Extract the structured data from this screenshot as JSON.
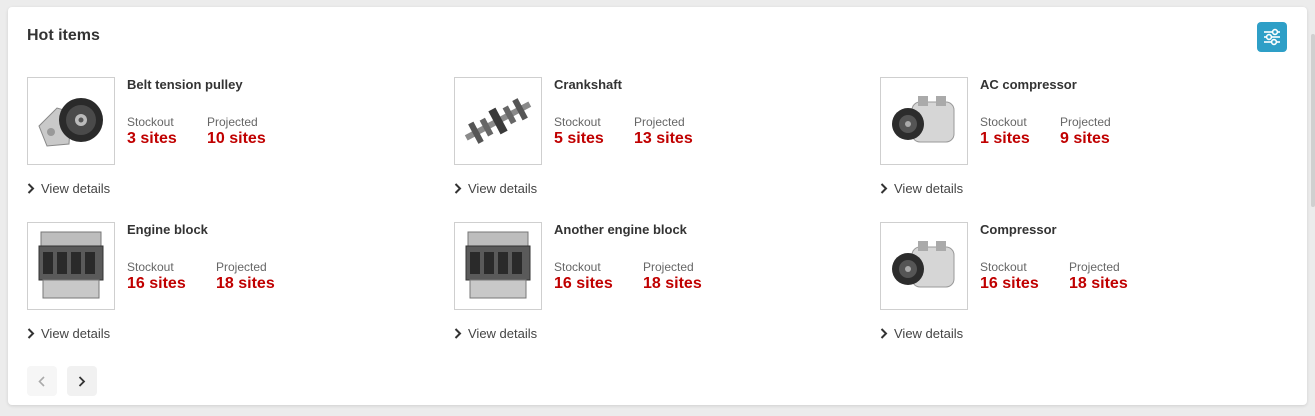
{
  "widget": {
    "title": "Hot items",
    "filter_icon": "sliders-icon",
    "accent_color": "#2e9fc7",
    "value_color": "#c00000"
  },
  "items": [
    {
      "name": "Belt tension pulley",
      "stockout_label": "Stockout",
      "stockout_value": "3 sites",
      "projected_label": "Projected",
      "projected_value": "10 sites",
      "link": "View details",
      "image": "pulley"
    },
    {
      "name": "Crankshaft",
      "stockout_label": "Stockout",
      "stockout_value": "5 sites",
      "projected_label": "Projected",
      "projected_value": "13 sites",
      "link": "View details",
      "image": "crankshaft"
    },
    {
      "name": "AC compressor",
      "stockout_label": "Stockout",
      "stockout_value": "1 sites",
      "projected_label": "Projected",
      "projected_value": "9 sites",
      "link": "View details",
      "image": "compressor"
    },
    {
      "name": "Engine block",
      "stockout_label": "Stockout",
      "stockout_value": "16 sites",
      "projected_label": "Projected",
      "projected_value": "18 sites",
      "link": "View details",
      "image": "engine"
    },
    {
      "name": "Another engine block",
      "stockout_label": "Stockout",
      "stockout_value": "16 sites",
      "projected_label": "Projected",
      "projected_value": "18 sites",
      "link": "View details",
      "image": "engine"
    },
    {
      "name": "Compressor",
      "stockout_label": "Stockout",
      "stockout_value": "16 sites",
      "projected_label": "Projected",
      "projected_value": "18 sites",
      "link": "View details",
      "image": "compressor"
    }
  ],
  "pagination": {
    "prev_icon": "chevron-left-icon",
    "next_icon": "chevron-right-icon"
  }
}
